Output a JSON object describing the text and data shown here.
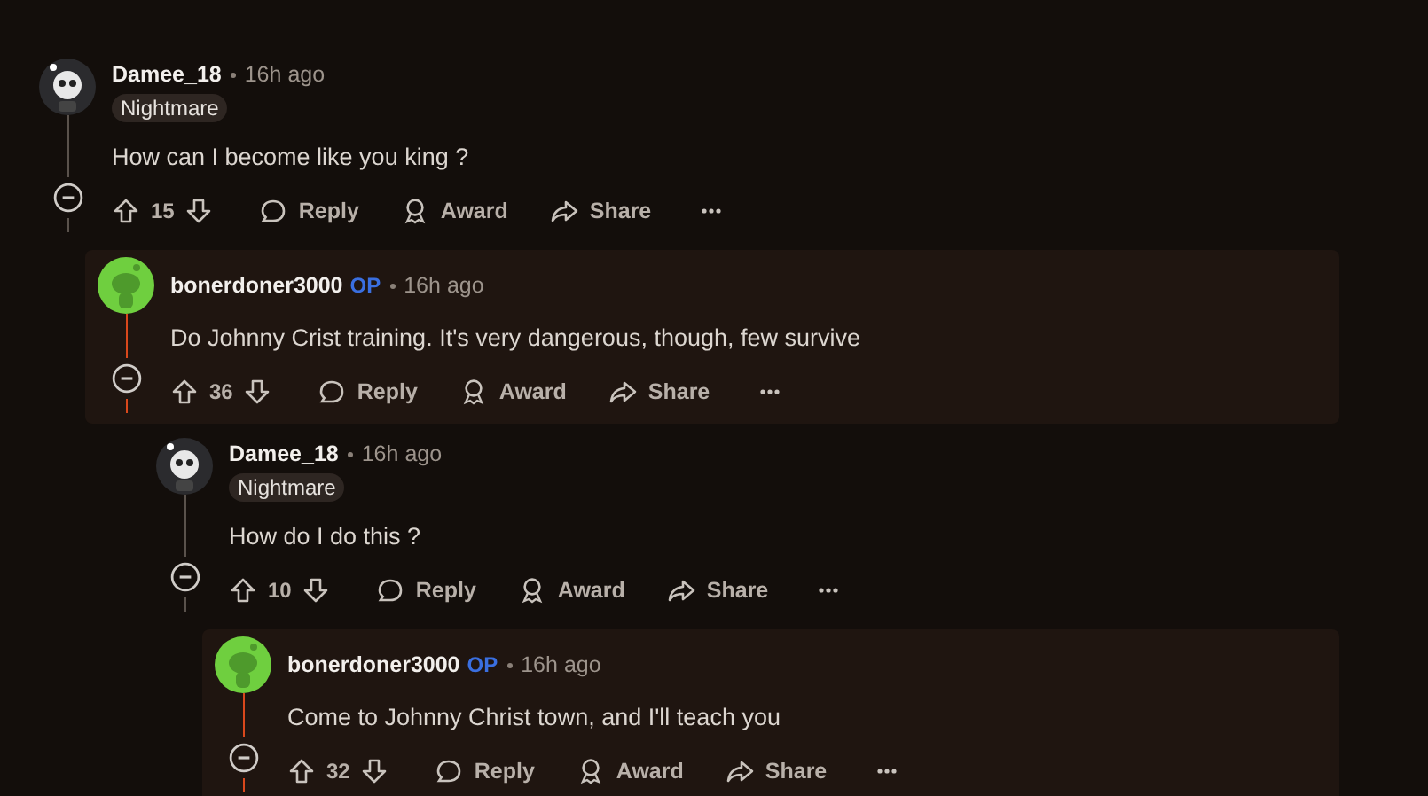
{
  "comments": [
    {
      "author": "Damee_18",
      "kind": "dark",
      "time": "16h ago",
      "flair": "Nightmare",
      "highlighted": false,
      "body": "How can I become like you king ?",
      "votes": "15",
      "actions": [
        "Reply",
        "Award",
        "Share"
      ],
      "children": [
        {
          "author": "bonerdoner3000",
          "kind": "green",
          "badge": "OP",
          "time": "16h ago",
          "highlighted": true,
          "body": "Do Johnny Crist training. It's very dangerous, though, few survive",
          "votes": "36",
          "actions": [
            "Reply",
            "Award",
            "Share"
          ],
          "children": [
            {
              "author": "Damee_18",
              "kind": "dark",
              "time": "16h ago",
              "flair": "Nightmare",
              "highlighted": false,
              "body": "How do I do this ?",
              "votes": "10",
              "actions": [
                "Reply",
                "Award",
                "Share"
              ],
              "children": [
                {
                  "author": "bonerdoner3000",
                  "kind": "green",
                  "badge": "OP",
                  "time": "16h ago",
                  "highlighted": true,
                  "body": "Come to Johnny Christ town, and I'll teach you",
                  "votes": "32",
                  "actions": [
                    "Reply",
                    "Award",
                    "Share"
                  ]
                }
              ]
            }
          ]
        }
      ]
    }
  ]
}
